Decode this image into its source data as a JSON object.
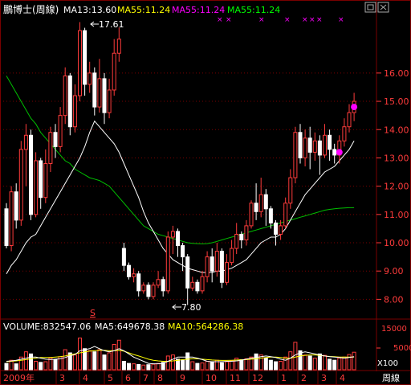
{
  "header": {
    "title": "鵬博士(周線)",
    "ma_items": [
      {
        "label": "MA13:13.60",
        "color": "#ffffff"
      },
      {
        "label": "MA55:11.24",
        "color": "#ffff00"
      },
      {
        "label": "MA55:11.24",
        "color": "#ff00ff"
      },
      {
        "label": "MA55:11.24",
        "color": "#00ff00"
      }
    ]
  },
  "price_axis": {
    "ticks": [
      "16.00",
      "15.00",
      "14.00",
      "13.00",
      "12.00",
      "11.00",
      "10.00",
      "9.00",
      "8.00"
    ]
  },
  "annotations": {
    "high": "17.61",
    "low": "7.80",
    "marker": "S"
  },
  "volume_header": {
    "volume": "VOLUME:832547.06",
    "ma5": "MA5:649678.38",
    "ma10": "MA10:564286.38"
  },
  "volume_axis": {
    "ticks": [
      "15000",
      "5000"
    ],
    "unit": "X100"
  },
  "time_axis": {
    "labels": [
      "2009年",
      "3",
      "4",
      "5",
      "6",
      "7",
      "8",
      "9",
      "10",
      "11",
      "12",
      "1",
      "2",
      "3",
      "4"
    ],
    "period": "周線"
  },
  "colors": {
    "up": "#ff3b3b",
    "down": "#ffffff",
    "ma_short": "#ffffff",
    "ma_long": "#00c000",
    "grid": "#7a0000",
    "axis_text": "#ff3b3b",
    "marker": "#ff00ff",
    "ma5_vol": "#ffffff",
    "ma10_vol": "#ffff00"
  },
  "chart_data": {
    "type": "candlestick",
    "ylim": [
      7.5,
      17.9
    ],
    "candles": [
      [
        11.2,
        9.9,
        9.8,
        11.4
      ],
      [
        9.9,
        11.8,
        9.7,
        12.0
      ],
      [
        11.8,
        10.8,
        10.5,
        12.1
      ],
      [
        10.8,
        13.3,
        10.6,
        13.6
      ],
      [
        13.3,
        13.8,
        12.0,
        14.2
      ],
      [
        13.8,
        11.0,
        10.8,
        14.0
      ],
      [
        11.0,
        12.9,
        10.9,
        13.2
      ],
      [
        12.9,
        11.6,
        11.2,
        13.0
      ],
      [
        11.6,
        12.8,
        11.4,
        13.3
      ],
      [
        12.8,
        13.9,
        12.5,
        14.1
      ],
      [
        13.9,
        13.4,
        13.0,
        14.2
      ],
      [
        13.4,
        14.5,
        13.2,
        14.8
      ],
      [
        14.5,
        15.9,
        14.2,
        16.2
      ],
      [
        15.9,
        14.1,
        13.8,
        16.0
      ],
      [
        14.1,
        15.2,
        13.9,
        15.6
      ],
      [
        15.2,
        17.5,
        15.0,
        17.8
      ],
      [
        17.5,
        15.6,
        15.2,
        17.6
      ],
      [
        15.6,
        16.0,
        15.3,
        16.4
      ],
      [
        16.0,
        14.8,
        14.5,
        16.2
      ],
      [
        14.8,
        15.8,
        14.6,
        16.5
      ],
      [
        15.8,
        14.6,
        14.2,
        16.0
      ],
      [
        14.6,
        15.4,
        14.4,
        15.8
      ],
      [
        15.4,
        16.7,
        15.2,
        17.2
      ],
      [
        16.7,
        17.2,
        16.4,
        17.61
      ],
      [
        9.8,
        9.2,
        9.0,
        10.0
      ],
      [
        9.2,
        8.8,
        8.7,
        9.3
      ],
      [
        8.8,
        8.9,
        8.6,
        9.1
      ],
      [
        8.9,
        8.3,
        8.1,
        9.0
      ],
      [
        8.3,
        8.5,
        8.2,
        8.6
      ],
      [
        8.5,
        8.1,
        8.0,
        8.6
      ],
      [
        8.1,
        8.5,
        8.0,
        8.6
      ],
      [
        8.5,
        8.7,
        8.4,
        9.0
      ],
      [
        8.7,
        8.3,
        8.1,
        8.8
      ],
      [
        8.3,
        10.2,
        8.2,
        10.4
      ],
      [
        10.2,
        10.4,
        9.6,
        10.6
      ],
      [
        10.4,
        9.9,
        9.5,
        10.5
      ],
      [
        9.9,
        9.5,
        9.0,
        10.0
      ],
      [
        9.5,
        8.4,
        7.8,
        9.6
      ],
      [
        8.4,
        8.6,
        8.3,
        8.8
      ],
      [
        8.6,
        8.3,
        8.2,
        8.7
      ],
      [
        8.3,
        8.8,
        8.2,
        9.0
      ],
      [
        8.8,
        9.5,
        8.6,
        9.7
      ],
      [
        9.5,
        9.0,
        8.6,
        9.8
      ],
      [
        9.0,
        9.7,
        8.8,
        10.0
      ],
      [
        9.7,
        8.6,
        8.4,
        9.8
      ],
      [
        8.6,
        9.3,
        8.5,
        9.6
      ],
      [
        9.3,
        9.8,
        9.2,
        10.1
      ],
      [
        9.8,
        10.3,
        9.6,
        10.7
      ],
      [
        10.3,
        10.1,
        9.8,
        10.4
      ],
      [
        10.1,
        10.6,
        9.9,
        10.8
      ],
      [
        10.6,
        11.4,
        10.5,
        11.5
      ],
      [
        11.4,
        11.1,
        10.8,
        12.1
      ],
      [
        11.1,
        11.7,
        10.9,
        12.3
      ],
      [
        11.7,
        11.2,
        10.6,
        11.9
      ],
      [
        11.2,
        10.7,
        10.5,
        11.3
      ],
      [
        10.7,
        10.3,
        9.9,
        10.8
      ],
      [
        10.3,
        10.6,
        10.1,
        10.8
      ],
      [
        10.6,
        11.4,
        10.5,
        11.6
      ],
      [
        11.4,
        12.3,
        11.2,
        12.6
      ],
      [
        12.3,
        13.9,
        12.1,
        14.1
      ],
      [
        13.9,
        13.0,
        12.8,
        14.2
      ],
      [
        13.0,
        13.7,
        12.7,
        14.0
      ],
      [
        13.7,
        13.2,
        12.6,
        14.1
      ],
      [
        13.2,
        13.6,
        12.9,
        13.9
      ],
      [
        13.6,
        13.1,
        12.4,
        13.8
      ],
      [
        13.1,
        13.8,
        13.0,
        14.2
      ],
      [
        13.8,
        13.3,
        12.9,
        14.0
      ],
      [
        13.3,
        13.1,
        12.8,
        13.5
      ],
      [
        13.1,
        13.6,
        12.8,
        13.8
      ],
      [
        13.6,
        14.1,
        13.4,
        14.4
      ],
      [
        14.1,
        14.6,
        13.9,
        14.9
      ],
      [
        14.6,
        15.0,
        14.3,
        15.3
      ]
    ],
    "volume": [
      30,
      45,
      28,
      60,
      85,
      75,
      40,
      35,
      38,
      55,
      48,
      62,
      95,
      80,
      70,
      150,
      100,
      90,
      85,
      95,
      70,
      80,
      120,
      140,
      40,
      30,
      28,
      25,
      22,
      24,
      26,
      30,
      35,
      65,
      70,
      50,
      45,
      80,
      38,
      30,
      32,
      40,
      35,
      45,
      33,
      38,
      42,
      55,
      48,
      52,
      60,
      75,
      70,
      55,
      45,
      38,
      40,
      60,
      85,
      130,
      90,
      70,
      65,
      55,
      75,
      68,
      50,
      45,
      55,
      60,
      72,
      83
    ],
    "ma13": [
      8.9,
      9.2,
      9.4,
      9.7,
      10.0,
      10.2,
      10.3,
      10.6,
      10.9,
      11.2,
      11.5,
      11.8,
      12.1,
      12.4,
      12.7,
      13.0,
      13.4,
      13.9,
      14.3,
      14.1,
      13.9,
      13.7,
      13.5,
      13.2,
      12.8,
      12.4,
      12.0,
      11.6,
      11.1,
      10.7,
      10.4,
      10.1,
      9.8,
      9.6,
      9.4,
      9.3,
      9.2,
      9.1,
      9.05,
      9.0,
      8.95,
      8.95,
      8.95,
      9.0,
      9.0,
      9.05,
      9.1,
      9.2,
      9.3,
      9.4,
      9.6,
      9.8,
      10.0,
      10.1,
      10.2,
      10.2,
      10.3,
      10.5,
      10.8,
      11.1,
      11.4,
      11.7,
      11.9,
      12.1,
      12.3,
      12.5,
      12.6,
      12.7,
      12.9,
      13.1,
      13.3,
      13.6
    ],
    "ma55": [
      15.9,
      15.6,
      15.3,
      15.0,
      14.7,
      14.4,
      14.2,
      13.9,
      13.7,
      13.5,
      13.3,
      13.1,
      12.9,
      12.8,
      12.6,
      12.5,
      12.4,
      12.3,
      12.25,
      12.2,
      12.1,
      12.0,
      11.8,
      11.6,
      11.4,
      11.2,
      11.0,
      10.8,
      10.6,
      10.5,
      10.4,
      10.3,
      10.25,
      10.2,
      10.15,
      10.1,
      10.05,
      10.0,
      9.98,
      9.97,
      9.96,
      9.97,
      10.0,
      10.05,
      10.1,
      10.15,
      10.2,
      10.25,
      10.3,
      10.35,
      10.4,
      10.45,
      10.5,
      10.55,
      10.6,
      10.65,
      10.7,
      10.75,
      10.8,
      10.85,
      10.9,
      10.95,
      11.0,
      11.05,
      11.1,
      11.15,
      11.18,
      11.2,
      11.22,
      11.23,
      11.24,
      11.24
    ],
    "vol_ma5": [
      40,
      42,
      45,
      50,
      55,
      60,
      60,
      55,
      50,
      48,
      50,
      52,
      58,
      66,
      72,
      90,
      95,
      100,
      110,
      100,
      90,
      85,
      90,
      100,
      90,
      75,
      60,
      50,
      40,
      30,
      28,
      28,
      30,
      40,
      50,
      60,
      60,
      60,
      60,
      55,
      48,
      40,
      38,
      38,
      38,
      40,
      40,
      42,
      45,
      50,
      55,
      58,
      62,
      65,
      62,
      58,
      50,
      45,
      55,
      70,
      80,
      85,
      80,
      75,
      70,
      65,
      62,
      60,
      58,
      55,
      58,
      62
    ],
    "vol_ma10": [
      38,
      40,
      42,
      45,
      48,
      52,
      55,
      58,
      58,
      58,
      60,
      62,
      65,
      70,
      75,
      80,
      85,
      88,
      90,
      92,
      92,
      90,
      90,
      92,
      88,
      80,
      72,
      65,
      58,
      50,
      45,
      42,
      40,
      40,
      42,
      45,
      48,
      50,
      52,
      52,
      50,
      48,
      46,
      45,
      44,
      44,
      45,
      46,
      47,
      48,
      50,
      52,
      55,
      58,
      60,
      60,
      58,
      55,
      55,
      60,
      65,
      68,
      70,
      70,
      68,
      65,
      63,
      62,
      60,
      60,
      60,
      60
    ],
    "markers": [
      {
        "index": 68,
        "price": 13.2
      },
      {
        "index": 71,
        "price": 14.8
      }
    ]
  }
}
